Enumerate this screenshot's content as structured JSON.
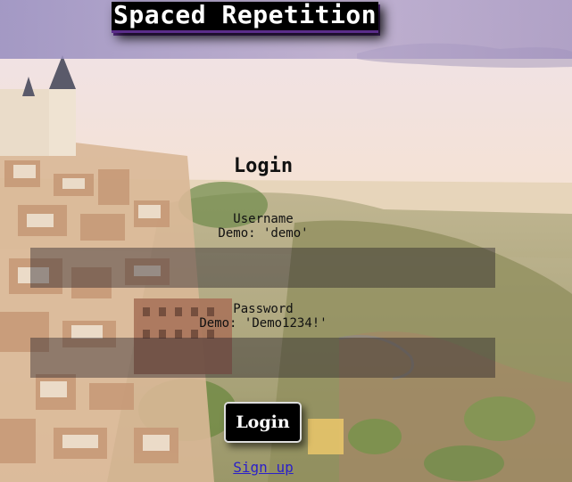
{
  "header": {
    "app_title": "Spaced Repetition"
  },
  "form": {
    "title": "Login",
    "username": {
      "label": "Username",
      "hint": "Demo: 'demo'",
      "value": "",
      "placeholder": ""
    },
    "password": {
      "label": "Password",
      "hint": "Demo: 'Demo1234!'",
      "value": "",
      "placeholder": ""
    },
    "submit_label": "Login",
    "signup_label": "Sign up"
  },
  "colors": {
    "title_bar": "#000000",
    "title_shadow": "#5b2d8a",
    "link": "#2a1fc9",
    "input_fill": "#231e28"
  }
}
